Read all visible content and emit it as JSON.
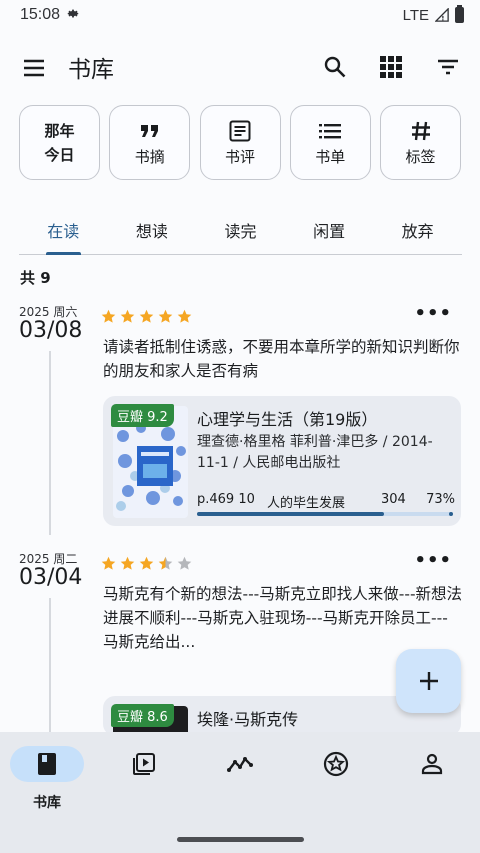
{
  "status_bar": {
    "time": "15:08",
    "network": "LTE"
  },
  "header": {
    "title": "书库"
  },
  "quick_actions": [
    {
      "label": "那年今日",
      "line1": "那年",
      "line2": "今日",
      "icon": "calendar-text"
    },
    {
      "label": "书摘",
      "icon": "quote-icon"
    },
    {
      "label": "书评",
      "icon": "article-icon"
    },
    {
      "label": "书单",
      "icon": "list-icon"
    },
    {
      "label": "标签",
      "icon": "hashtag-icon"
    }
  ],
  "tabs": [
    {
      "label": "在读",
      "active": true
    },
    {
      "label": "想读"
    },
    {
      "label": "读完"
    },
    {
      "label": "闲置"
    },
    {
      "label": "放弃"
    }
  ],
  "count_label": "共 9",
  "entries": [
    {
      "year_weekday": "2025 周六",
      "date": "03/08",
      "rating": 5,
      "quote": "请读者抵制住诱惑，不要用本章所学的新知识判断你的朋友和家人是否有病",
      "book": {
        "rating_badge": "豆瓣 9.2",
        "title": "心理学与生活（第19版）",
        "meta": "理查德·格里格  菲利普·津巴多 / 2014-11-1 / 人民邮电出版社",
        "cover_text": "心理学与生活",
        "progress_page": "p.469 10",
        "chapter": "人的毕生发展",
        "page_total": "304",
        "percent": "73%",
        "progress": 0.73
      }
    },
    {
      "year_weekday": "2025 周二",
      "date": "03/04",
      "rating": 3.5,
      "quote": "马斯克有个新的想法---马斯克立即找人来做---新想法进展不顺利---马斯克入驻现场---马斯克开除员工---马斯克给出...",
      "book": {
        "rating_badge": "豆瓣 8.6",
        "title": "埃隆·马斯克传"
      }
    }
  ],
  "bottom_nav": [
    {
      "label": "书库",
      "icon": "book-icon",
      "active": true
    },
    {
      "icon": "video-library-icon"
    },
    {
      "icon": "stats-icon"
    },
    {
      "icon": "star-badge-icon"
    },
    {
      "icon": "person-icon"
    }
  ],
  "colors": {
    "accent": "#2a5f8f",
    "star": "#f5a623",
    "badge": "#2e8b40",
    "fab": "#cfe4fb"
  }
}
